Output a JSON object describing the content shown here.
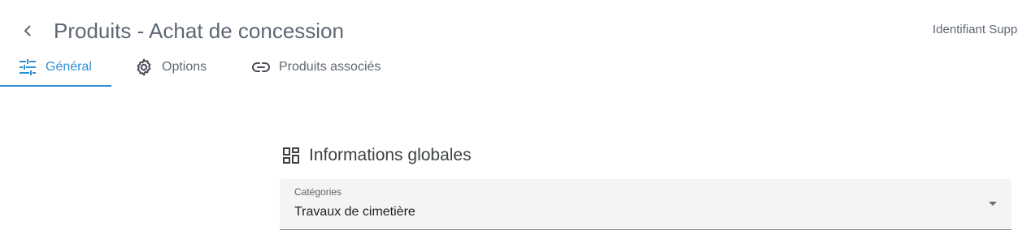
{
  "header": {
    "title": "Produits - Achat de concession",
    "support_id_label": "Identifiant Supp"
  },
  "tabs": [
    {
      "label": "Général",
      "icon": "tune-icon",
      "active": true
    },
    {
      "label": "Options",
      "icon": "gear-icon",
      "active": false
    },
    {
      "label": "Produits associés",
      "icon": "link-icon",
      "active": false
    }
  ],
  "colors": {
    "accent": "#2f8fd6",
    "title_text": "#5f6775",
    "field_background": "#f4f4f4"
  },
  "section": {
    "icon": "dashboard-icon",
    "title": "Informations globales"
  },
  "categories_field": {
    "label": "Catégories",
    "value": "Travaux de cimetière"
  }
}
